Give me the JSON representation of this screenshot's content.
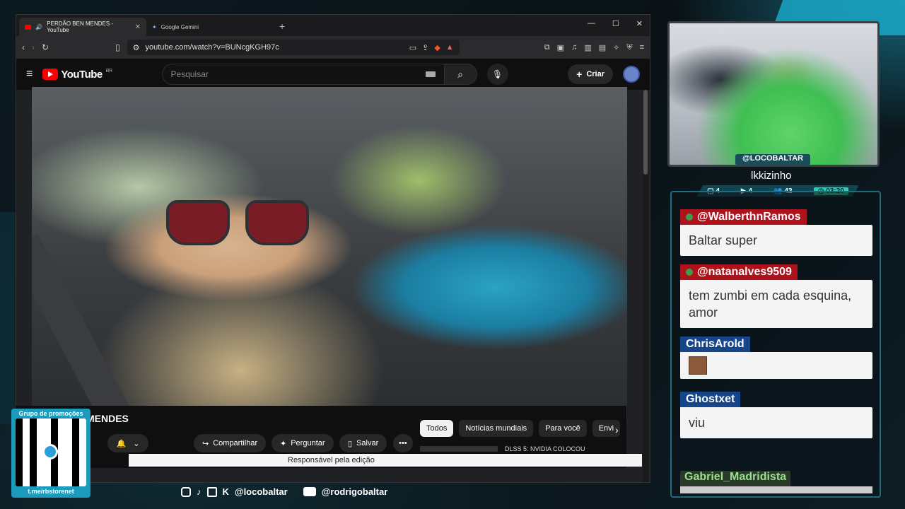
{
  "browser": {
    "tabs": [
      {
        "label": "PERDÃO BEN MENDES - YouTube",
        "active": true
      },
      {
        "label": "Google Gemini",
        "active": false
      }
    ],
    "url": "youtube.com/watch?v=BUNcgKGH97c"
  },
  "youtube": {
    "logo_text": "YouTube",
    "region": "BR",
    "search_placeholder": "Pesquisar",
    "create_label": "Criar",
    "title_fragment": "MENDES",
    "actions": {
      "share": "Compartilhar",
      "ask": "Perguntar",
      "save": "Salvar",
      "more": "•••"
    },
    "chips": [
      "Todos",
      "Notícias mundiais",
      "Para você",
      "Envi"
    ],
    "recommendation": "DLSS 5: NVIDIA COLOCOU",
    "tooltip": "Responsável pela edição"
  },
  "stream": {
    "cam_tag": "@LOCOBALTAR",
    "cam_user": "lkkizinho",
    "stats": {
      "chat": "4",
      "video": "4",
      "viewers": "42",
      "time": "03:20"
    },
    "chat": [
      {
        "user": "@WalberthnRamos",
        "text": "Baltar super",
        "color": "red"
      },
      {
        "user": "@natanalves9509",
        "text": "tem zumbi em cada esquina, amor",
        "color": "red"
      },
      {
        "user": "ChrisArold",
        "text": "",
        "color": "blue",
        "emote": true
      },
      {
        "user": "Ghostxet",
        "text": "viu",
        "color": "blue"
      }
    ],
    "last_user": "Gabriel_Madridista",
    "promo": {
      "title": "Grupo de promoções",
      "link": "t.me/rbstorenet"
    },
    "socials": {
      "handle1": "@locobaltar",
      "handle2": "@rodrigobaltar"
    }
  },
  "colors": {
    "accent": "#1aa6c4",
    "yt_red": "#ff0000",
    "chat_red": "#b0121c",
    "chat_blue": "#16458a"
  }
}
